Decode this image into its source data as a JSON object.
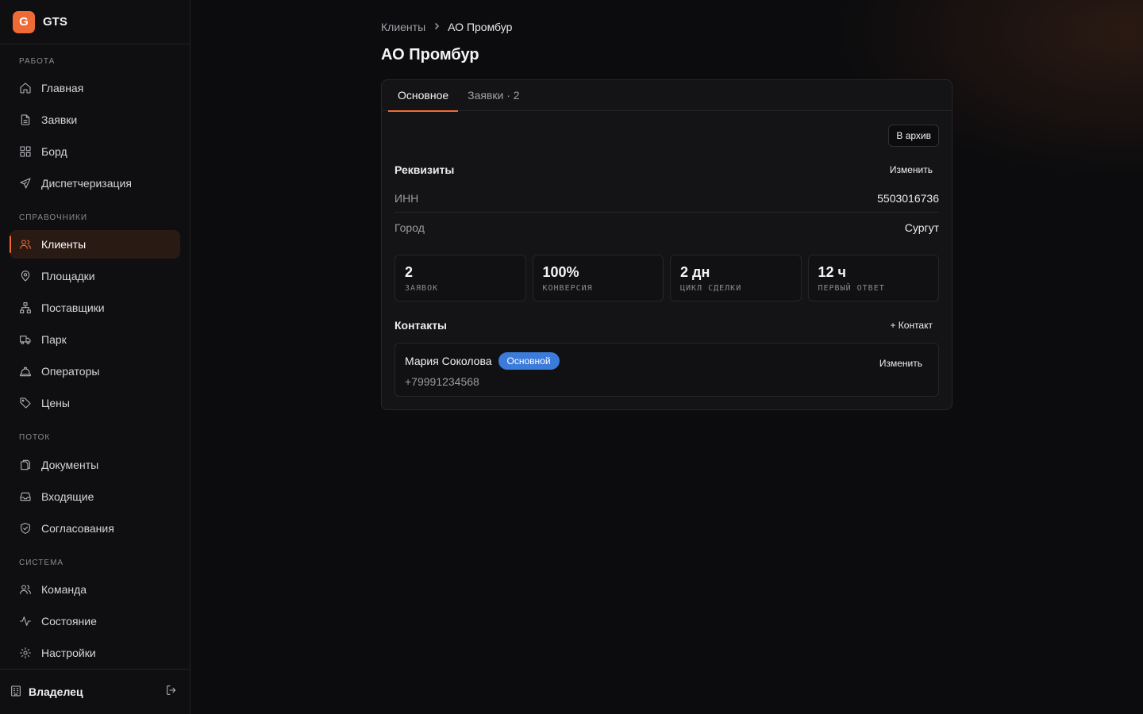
{
  "app": {
    "logo_letter": "G",
    "name": "GTS"
  },
  "sidebar": {
    "sections": [
      {
        "label": "РАБОТА",
        "items": [
          {
            "label": "Главная",
            "icon": "home-icon"
          },
          {
            "label": "Заявки",
            "icon": "document-icon"
          },
          {
            "label": "Борд",
            "icon": "grid-icon"
          },
          {
            "label": "Диспетчеризация",
            "icon": "send-icon"
          }
        ]
      },
      {
        "label": "СПРАВОЧНИКИ",
        "items": [
          {
            "label": "Клиенты",
            "icon": "users-icon",
            "active": true
          },
          {
            "label": "Площадки",
            "icon": "map-pin-icon"
          },
          {
            "label": "Поставщики",
            "icon": "network-icon"
          },
          {
            "label": "Парк",
            "icon": "truck-icon"
          },
          {
            "label": "Операторы",
            "icon": "hard-hat-icon"
          },
          {
            "label": "Цены",
            "icon": "tag-icon"
          }
        ]
      },
      {
        "label": "ПОТОК",
        "items": [
          {
            "label": "Документы",
            "icon": "documents-icon"
          },
          {
            "label": "Входящие",
            "icon": "inbox-icon"
          },
          {
            "label": "Согласования",
            "icon": "shield-check-icon"
          }
        ]
      },
      {
        "label": "СИСТЕМА",
        "items": [
          {
            "label": "Команда",
            "icon": "team-icon"
          },
          {
            "label": "Состояние",
            "icon": "activity-icon"
          },
          {
            "label": "Настройки",
            "icon": "gear-icon"
          }
        ]
      }
    ],
    "footer": {
      "user_label": "Владелец",
      "icon": "building-icon",
      "logout_icon": "logout-icon"
    }
  },
  "breadcrumb": {
    "parent": "Клиенты",
    "current": "АО Промбур"
  },
  "page": {
    "title": "АО Промбур"
  },
  "tabs": [
    {
      "label": "Основное",
      "active": true
    },
    {
      "label": "Заявки · 2",
      "active": false
    }
  ],
  "actions": {
    "archive_label": "В архив"
  },
  "requisites": {
    "title": "Реквизиты",
    "edit_label": "Изменить",
    "rows": [
      {
        "key": "ИНН",
        "value": "5503016736"
      },
      {
        "key": "Город",
        "value": "Сургут"
      }
    ]
  },
  "stats": [
    {
      "value": "2",
      "label": "ЗАЯВОК"
    },
    {
      "value": "100%",
      "label": "КОНВЕРСИЯ"
    },
    {
      "value": "2 дн",
      "label": "ЦИКЛ СДЕЛКИ"
    },
    {
      "value": "12 ч",
      "label": "ПЕРВЫЙ ОТВЕТ"
    }
  ],
  "contacts": {
    "title": "Контакты",
    "add_label": "+ Контакт",
    "items": [
      {
        "name": "Мария Соколова",
        "badge": "Основной",
        "phone": "+79991234568",
        "edit_label": "Изменить"
      }
    ]
  },
  "colors": {
    "accent": "#f06a35",
    "badge_blue": "#3b7bdc",
    "background": "#0c0c0e"
  }
}
